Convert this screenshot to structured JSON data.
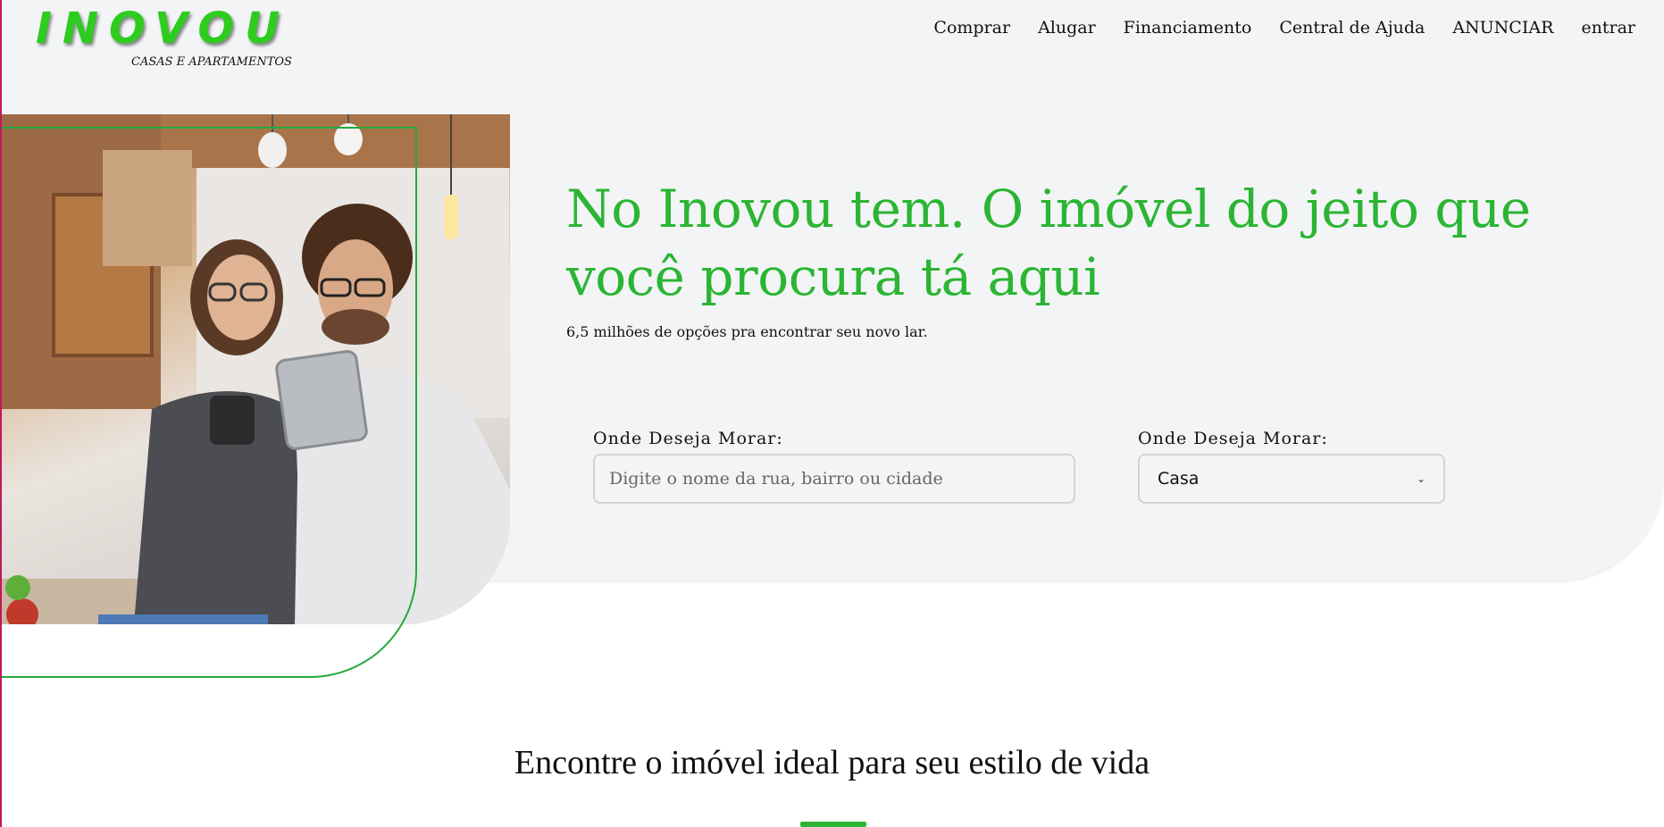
{
  "brand": {
    "name": "INOVOU",
    "tagline": "CASAS E APARTAMENTOS",
    "accent_color": "#2bb533"
  },
  "nav": {
    "items": [
      "Comprar",
      "Alugar",
      "Financiamento",
      "Central de Ajuda",
      "ANUNCIAR",
      "entrar"
    ]
  },
  "hero": {
    "headline": "No Inovou tem. O imóvel do jeito que você procura tá aqui",
    "subtitle": "6,5 milhões de opções pra encontrar seu novo lar.",
    "photo_icon": "couple-with-tablet-photo"
  },
  "search": {
    "location_label": "Onde Deseja Morar:",
    "location_placeholder": "Digite o nome da rua, bairro ou cidade",
    "location_value": "",
    "type_label": "Onde Deseja Morar:",
    "type_selected": "Casa"
  },
  "section": {
    "title": "Encontre o imóvel ideal para seu estilo de vida"
  }
}
